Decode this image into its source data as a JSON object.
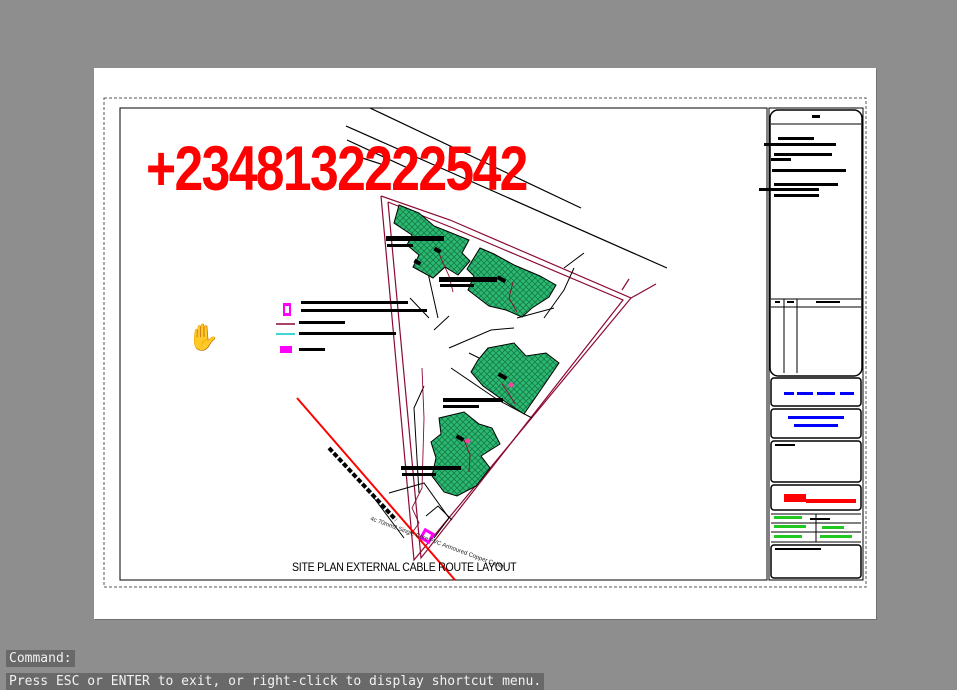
{
  "drawing": {
    "watermark_phone": "+2348132222542",
    "sheet_title": "SITE PLAN EXTERNAL CABLE ROUTE LAYOUT",
    "cable_label": "4c 70mm2 Single Core PVC Armoured Copper Cable"
  },
  "command_line": {
    "prompt": "Command:",
    "message": "Press ESC or ENTER to exit, or right-click to display shortcut menu."
  },
  "cursor": {
    "icon": "pan-hand-icon",
    "glyph": "✋"
  },
  "colors": {
    "canvas_bg": "#8e8e8e",
    "paper": "#ffffff",
    "building_fill": "#2db871",
    "boundary": "#8b0a32",
    "cable": "#ff0000",
    "meter": "#ff00ff",
    "command_bg": "#696969"
  }
}
